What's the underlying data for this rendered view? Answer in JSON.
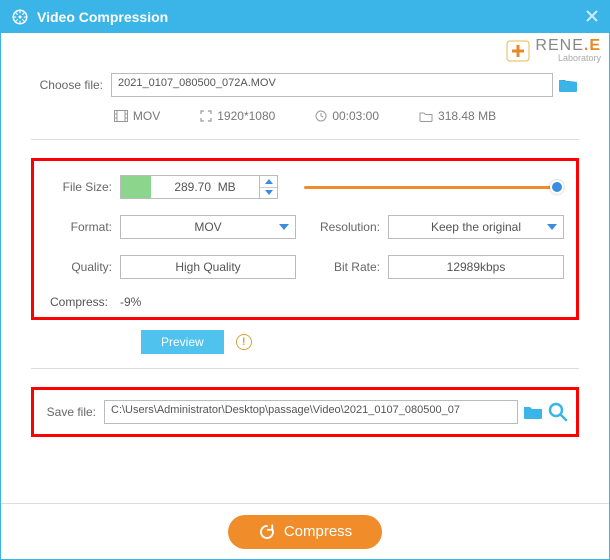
{
  "title": "Video Compression",
  "brand": {
    "text": "RENE",
    "dot": ".",
    "e": "E",
    "sub": "Laboratory"
  },
  "choose": {
    "label": "Choose file:",
    "value": "2021_0107_080500_072A.MOV"
  },
  "meta": {
    "format": "MOV",
    "resolution": "1920*1080",
    "duration": "00:03:00",
    "size": "318.48 MB"
  },
  "settings": {
    "filesize_label": "File Size:",
    "filesize_value": "289.70",
    "filesize_unit": "MB",
    "format_label": "Format:",
    "format_value": "MOV",
    "resolution_label": "Resolution:",
    "resolution_value": "Keep the original",
    "quality_label": "Quality:",
    "quality_value": "High Quality",
    "bitrate_label": "Bit Rate:",
    "bitrate_value": "12989kbps",
    "compress_label": "Compress:",
    "compress_value": "-9%"
  },
  "preview_label": "Preview",
  "save": {
    "label": "Save file:",
    "value": "C:\\Users\\Administrator\\Desktop\\passage\\Video\\2021_0107_080500_07"
  },
  "compress_button": "Compress",
  "colors": {
    "accent_blue": "#3bb5e8",
    "accent_orange": "#f08c2a",
    "highlight_red": "#f00"
  }
}
